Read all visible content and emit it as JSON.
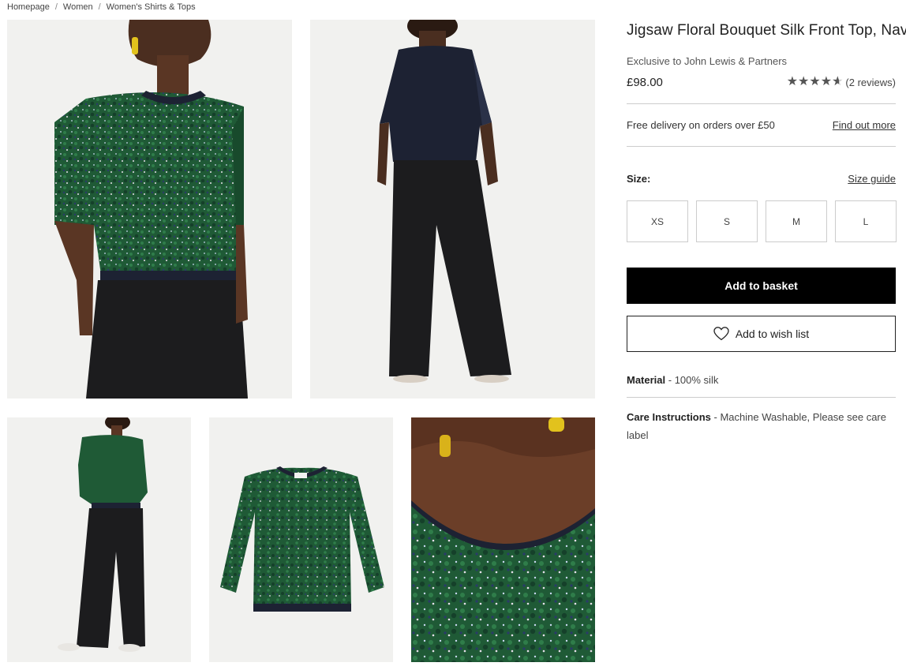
{
  "breadcrumb": [
    "Homepage",
    "Women",
    "Women's Shirts & Tops"
  ],
  "breadcrumb_separator": "/",
  "product": {
    "title": "Jigsaw Floral Bouquet Silk Front Top, Navy",
    "exclusive": "Exclusive to John Lewis & Partners",
    "price": "£98.00",
    "rating_value": 4.5,
    "rating_max": 5,
    "reviews": "(2 reviews)"
  },
  "delivery": {
    "text": "Free delivery on orders over £50",
    "link": "Find out more"
  },
  "size": {
    "label": "Size:",
    "guide": "Size guide",
    "options": [
      "XS",
      "S",
      "M",
      "L"
    ]
  },
  "actions": {
    "basket": "Add to basket",
    "wishlist": "Add to wish list"
  },
  "details": {
    "material_label": "Material",
    "material_value": " - 100% silk",
    "care_label": "Care Instructions",
    "care_value": " - Machine Washable, Please see care label"
  },
  "colors": {
    "accent": "#000000",
    "top_green": "#1f5a36",
    "navy": "#1d2233",
    "photo_bg": "#f1f1ef",
    "earring": "#e2c21d"
  },
  "icons": {
    "wishlist": "heart-icon",
    "rating": "star-icon"
  }
}
